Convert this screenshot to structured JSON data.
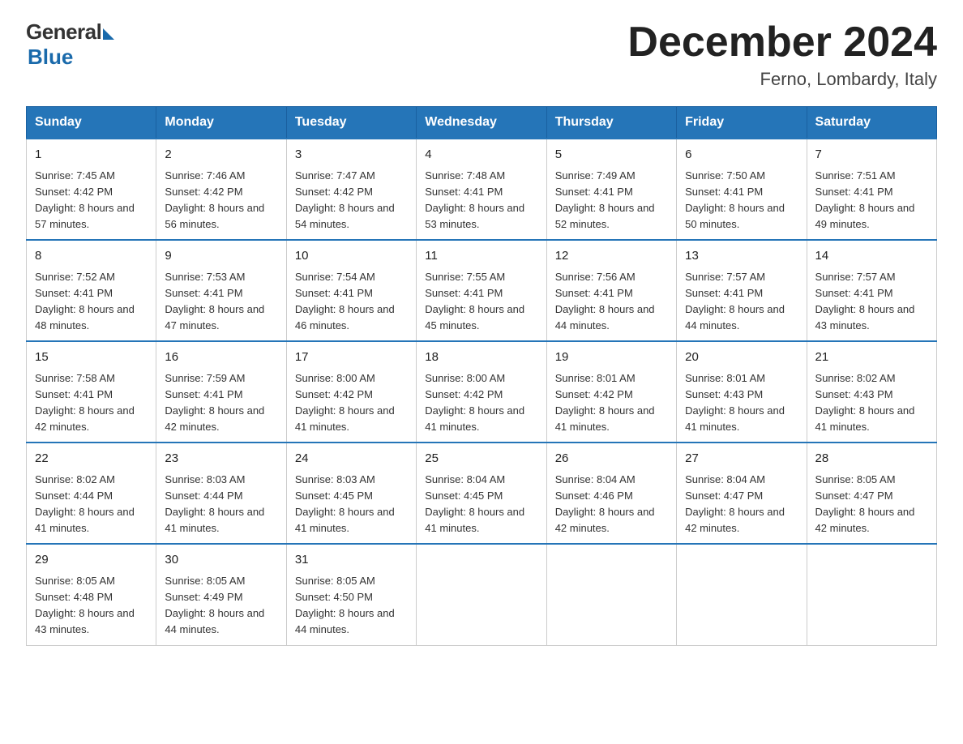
{
  "header": {
    "logo_general": "General",
    "logo_blue": "Blue",
    "main_title": "December 2024",
    "subtitle": "Ferno, Lombardy, Italy"
  },
  "days_of_week": [
    "Sunday",
    "Monday",
    "Tuesday",
    "Wednesday",
    "Thursday",
    "Friday",
    "Saturday"
  ],
  "weeks": [
    [
      {
        "num": "1",
        "sunrise": "7:45 AM",
        "sunset": "4:42 PM",
        "daylight": "8 hours and 57 minutes."
      },
      {
        "num": "2",
        "sunrise": "7:46 AM",
        "sunset": "4:42 PM",
        "daylight": "8 hours and 56 minutes."
      },
      {
        "num": "3",
        "sunrise": "7:47 AM",
        "sunset": "4:42 PM",
        "daylight": "8 hours and 54 minutes."
      },
      {
        "num": "4",
        "sunrise": "7:48 AM",
        "sunset": "4:41 PM",
        "daylight": "8 hours and 53 minutes."
      },
      {
        "num": "5",
        "sunrise": "7:49 AM",
        "sunset": "4:41 PM",
        "daylight": "8 hours and 52 minutes."
      },
      {
        "num": "6",
        "sunrise": "7:50 AM",
        "sunset": "4:41 PM",
        "daylight": "8 hours and 50 minutes."
      },
      {
        "num": "7",
        "sunrise": "7:51 AM",
        "sunset": "4:41 PM",
        "daylight": "8 hours and 49 minutes."
      }
    ],
    [
      {
        "num": "8",
        "sunrise": "7:52 AM",
        "sunset": "4:41 PM",
        "daylight": "8 hours and 48 minutes."
      },
      {
        "num": "9",
        "sunrise": "7:53 AM",
        "sunset": "4:41 PM",
        "daylight": "8 hours and 47 minutes."
      },
      {
        "num": "10",
        "sunrise": "7:54 AM",
        "sunset": "4:41 PM",
        "daylight": "8 hours and 46 minutes."
      },
      {
        "num": "11",
        "sunrise": "7:55 AM",
        "sunset": "4:41 PM",
        "daylight": "8 hours and 45 minutes."
      },
      {
        "num": "12",
        "sunrise": "7:56 AM",
        "sunset": "4:41 PM",
        "daylight": "8 hours and 44 minutes."
      },
      {
        "num": "13",
        "sunrise": "7:57 AM",
        "sunset": "4:41 PM",
        "daylight": "8 hours and 44 minutes."
      },
      {
        "num": "14",
        "sunrise": "7:57 AM",
        "sunset": "4:41 PM",
        "daylight": "8 hours and 43 minutes."
      }
    ],
    [
      {
        "num": "15",
        "sunrise": "7:58 AM",
        "sunset": "4:41 PM",
        "daylight": "8 hours and 42 minutes."
      },
      {
        "num": "16",
        "sunrise": "7:59 AM",
        "sunset": "4:41 PM",
        "daylight": "8 hours and 42 minutes."
      },
      {
        "num": "17",
        "sunrise": "8:00 AM",
        "sunset": "4:42 PM",
        "daylight": "8 hours and 41 minutes."
      },
      {
        "num": "18",
        "sunrise": "8:00 AM",
        "sunset": "4:42 PM",
        "daylight": "8 hours and 41 minutes."
      },
      {
        "num": "19",
        "sunrise": "8:01 AM",
        "sunset": "4:42 PM",
        "daylight": "8 hours and 41 minutes."
      },
      {
        "num": "20",
        "sunrise": "8:01 AM",
        "sunset": "4:43 PM",
        "daylight": "8 hours and 41 minutes."
      },
      {
        "num": "21",
        "sunrise": "8:02 AM",
        "sunset": "4:43 PM",
        "daylight": "8 hours and 41 minutes."
      }
    ],
    [
      {
        "num": "22",
        "sunrise": "8:02 AM",
        "sunset": "4:44 PM",
        "daylight": "8 hours and 41 minutes."
      },
      {
        "num": "23",
        "sunrise": "8:03 AM",
        "sunset": "4:44 PM",
        "daylight": "8 hours and 41 minutes."
      },
      {
        "num": "24",
        "sunrise": "8:03 AM",
        "sunset": "4:45 PM",
        "daylight": "8 hours and 41 minutes."
      },
      {
        "num": "25",
        "sunrise": "8:04 AM",
        "sunset": "4:45 PM",
        "daylight": "8 hours and 41 minutes."
      },
      {
        "num": "26",
        "sunrise": "8:04 AM",
        "sunset": "4:46 PM",
        "daylight": "8 hours and 42 minutes."
      },
      {
        "num": "27",
        "sunrise": "8:04 AM",
        "sunset": "4:47 PM",
        "daylight": "8 hours and 42 minutes."
      },
      {
        "num": "28",
        "sunrise": "8:05 AM",
        "sunset": "4:47 PM",
        "daylight": "8 hours and 42 minutes."
      }
    ],
    [
      {
        "num": "29",
        "sunrise": "8:05 AM",
        "sunset": "4:48 PM",
        "daylight": "8 hours and 43 minutes."
      },
      {
        "num": "30",
        "sunrise": "8:05 AM",
        "sunset": "4:49 PM",
        "daylight": "8 hours and 44 minutes."
      },
      {
        "num": "31",
        "sunrise": "8:05 AM",
        "sunset": "4:50 PM",
        "daylight": "8 hours and 44 minutes."
      },
      null,
      null,
      null,
      null
    ]
  ],
  "labels": {
    "sunrise": "Sunrise:",
    "sunset": "Sunset:",
    "daylight": "Daylight:"
  }
}
